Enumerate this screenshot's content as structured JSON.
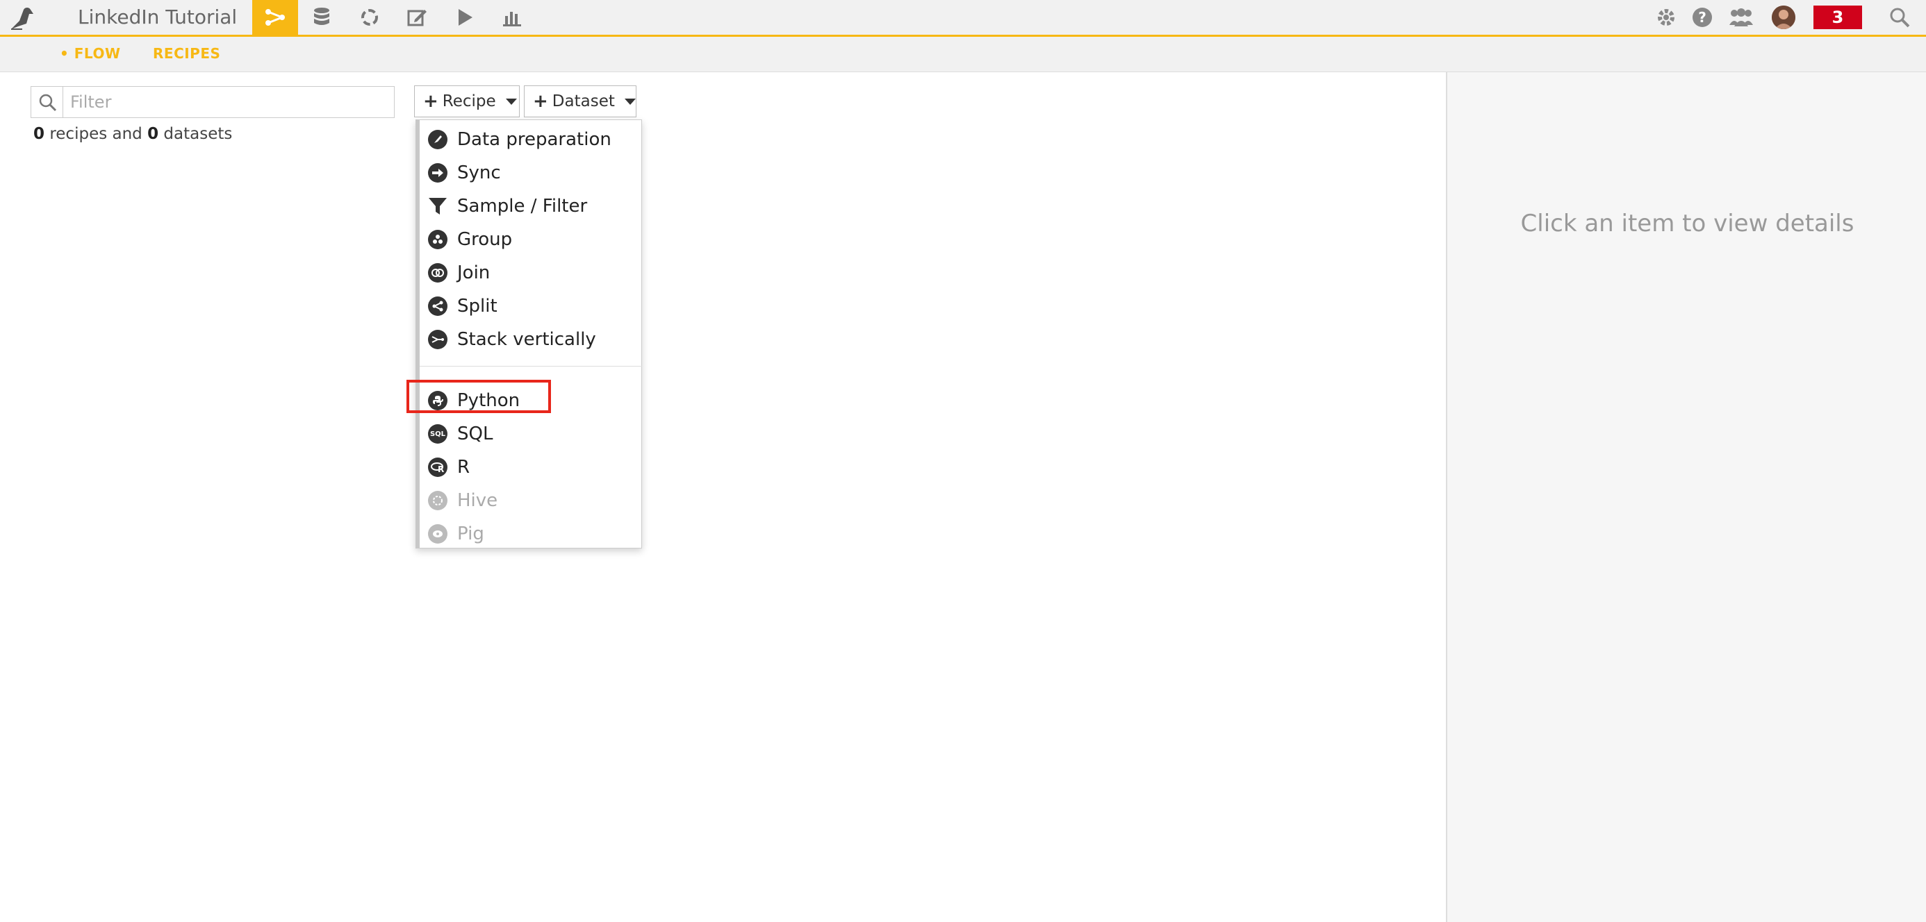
{
  "header": {
    "project_name": "LinkedIn Tutorial",
    "accent_color": "#f7b814",
    "nav": [
      {
        "icon": "flow-icon",
        "active": true
      },
      {
        "icon": "datasets-icon",
        "active": false
      },
      {
        "icon": "recipes-cycle-icon",
        "active": false
      },
      {
        "icon": "notebook-edit-icon",
        "active": false
      },
      {
        "icon": "play-icon",
        "active": false
      },
      {
        "icon": "charts-icon",
        "active": false
      }
    ],
    "notification_count": "3",
    "notification_color": "#d0021b"
  },
  "subnav": {
    "tabs": [
      {
        "label": "• FLOW"
      },
      {
        "label": "RECIPES"
      }
    ]
  },
  "filter": {
    "placeholder": "Filter",
    "value": ""
  },
  "counts": {
    "recipes": "0",
    "recipes_label": "recipes and",
    "datasets": "0",
    "datasets_label": "datasets"
  },
  "toolbar": {
    "recipe_label": "Recipe",
    "dataset_label": "Dataset"
  },
  "recipe_menu": {
    "visual": [
      {
        "label": "Data preparation",
        "icon": "brush-icon",
        "disabled": false
      },
      {
        "label": "Sync",
        "icon": "arrow-right-icon",
        "disabled": false
      },
      {
        "label": "Sample / Filter",
        "icon": "funnel-icon",
        "disabled": false
      },
      {
        "label": "Group",
        "icon": "group-icon",
        "disabled": false
      },
      {
        "label": "Join",
        "icon": "join-icon",
        "disabled": false
      },
      {
        "label": "Split",
        "icon": "split-icon",
        "disabled": false
      },
      {
        "label": "Stack vertically",
        "icon": "stack-icon",
        "disabled": false
      }
    ],
    "code": [
      {
        "label": "Python",
        "icon": "python-icon",
        "disabled": false
      },
      {
        "label": "SQL",
        "icon": "sql-icon",
        "disabled": false
      },
      {
        "label": "R",
        "icon": "r-icon",
        "disabled": false
      },
      {
        "label": "Hive",
        "icon": "hive-icon",
        "disabled": true
      },
      {
        "label": "Pig",
        "icon": "pig-icon",
        "disabled": true
      }
    ],
    "highlight_color": "#e8261b"
  },
  "details_panel": {
    "hint": "Click an item to view details"
  }
}
